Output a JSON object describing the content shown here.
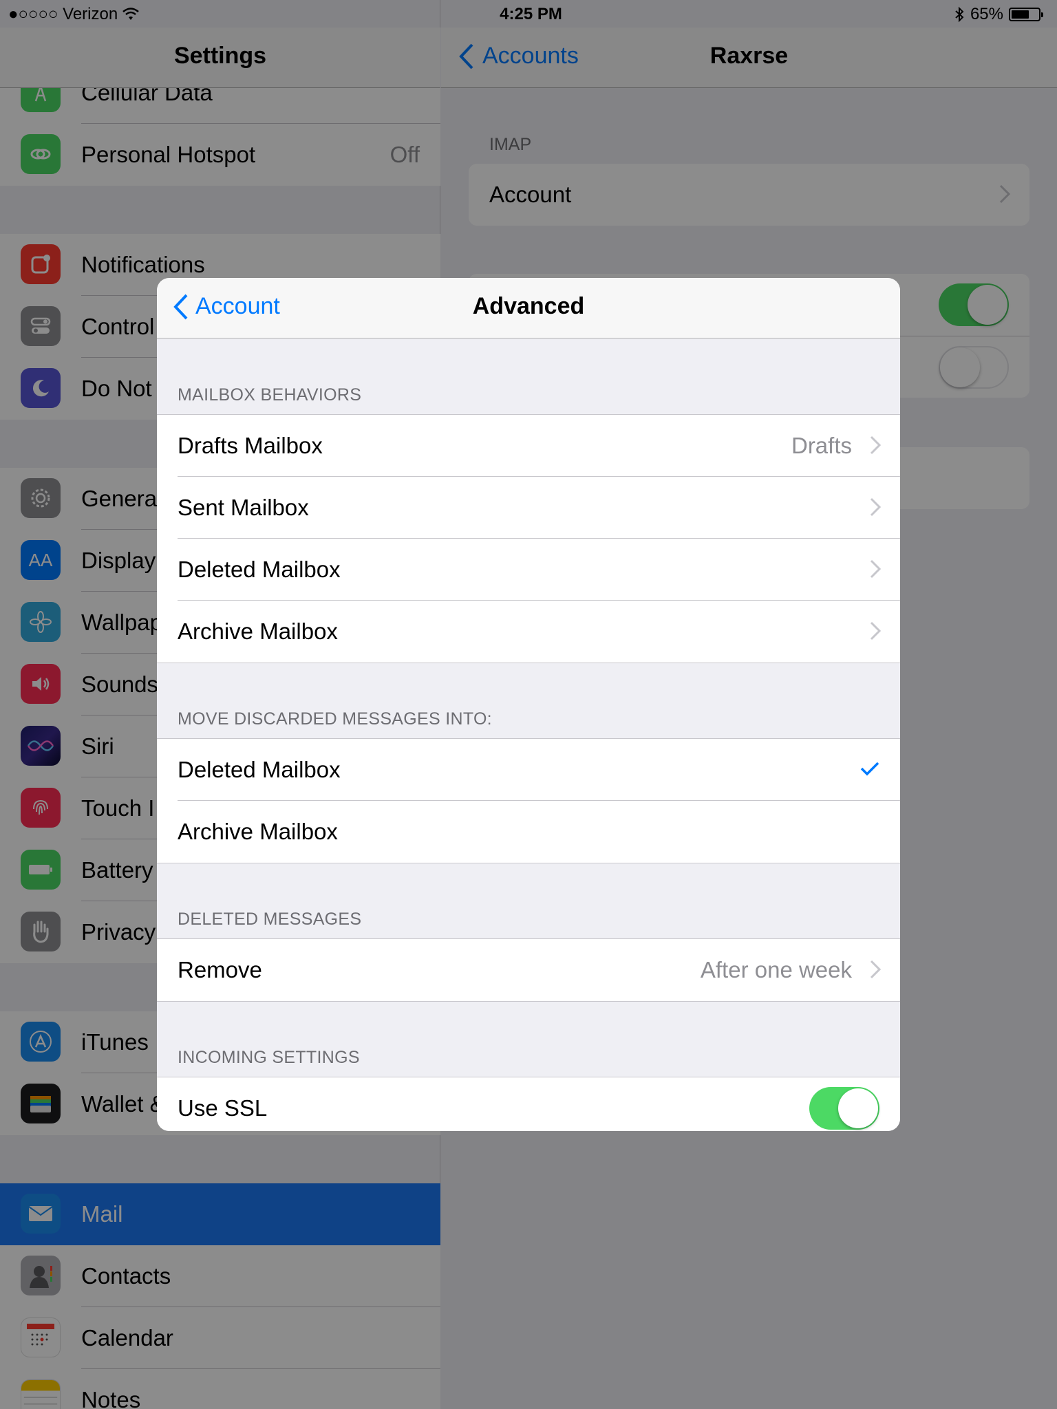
{
  "status": {
    "carrier": "●○○○○ Verizon",
    "time": "4:25 PM",
    "battery": "65%",
    "battery_fraction": 0.65
  },
  "left": {
    "title": "Settings",
    "items": [
      {
        "label": "Cellular Data",
        "value": ""
      },
      {
        "label": "Personal Hotspot",
        "value": "Off"
      },
      {
        "label": "Notifications",
        "value": ""
      },
      {
        "label": "Control",
        "value": ""
      },
      {
        "label": "Do Not",
        "value": ""
      },
      {
        "label": "Genera",
        "value": ""
      },
      {
        "label": "Display",
        "value": ""
      },
      {
        "label": "Wallpap",
        "value": ""
      },
      {
        "label": "Sounds",
        "value": ""
      },
      {
        "label": "Siri",
        "value": ""
      },
      {
        "label": "Touch I",
        "value": ""
      },
      {
        "label": "Battery",
        "value": ""
      },
      {
        "label": "Privacy",
        "value": ""
      },
      {
        "label": "iTunes",
        "value": ""
      },
      {
        "label": "Wallet &",
        "value": ""
      },
      {
        "label": "Mail",
        "value": ""
      },
      {
        "label": "Contacts",
        "value": ""
      },
      {
        "label": "Calendar",
        "value": ""
      },
      {
        "label": "Notes",
        "value": ""
      }
    ]
  },
  "right": {
    "back_label": "Accounts",
    "title": "Raxrse",
    "section_label": "IMAP",
    "account_label": "Account"
  },
  "modal": {
    "back_label": "Account",
    "title": "Advanced",
    "sections": {
      "mailbox_behaviors": {
        "label": "MAILBOX BEHAVIORS",
        "rows": [
          {
            "label": "Drafts Mailbox",
            "value": "Drafts"
          },
          {
            "label": "Sent Mailbox",
            "value": ""
          },
          {
            "label": "Deleted Mailbox",
            "value": ""
          },
          {
            "label": "Archive Mailbox",
            "value": ""
          }
        ]
      },
      "discarded": {
        "label": "MOVE DISCARDED MESSAGES INTO:",
        "rows": [
          {
            "label": "Deleted Mailbox",
            "checked": true
          },
          {
            "label": "Archive Mailbox",
            "checked": false
          }
        ]
      },
      "deleted_messages": {
        "label": "DELETED MESSAGES",
        "rows": [
          {
            "label": "Remove",
            "value": "After one week"
          }
        ]
      },
      "incoming": {
        "label": "INCOMING SETTINGS",
        "rows": [
          {
            "label": "Use SSL",
            "on": true
          }
        ]
      }
    }
  },
  "colors": {
    "accent": "#007aff",
    "toggle_on": "#4cd964",
    "selected_row": "#1d79f5"
  }
}
